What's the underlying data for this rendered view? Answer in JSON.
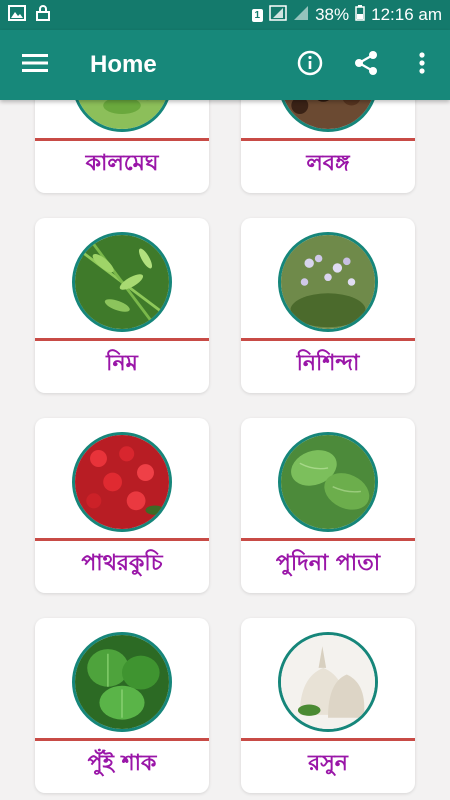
{
  "status_bar": {
    "battery": "38%",
    "time": "12:16 am",
    "sim_label": "1"
  },
  "app_bar": {
    "title": "Home",
    "menu_icon": "hamburger-menu-icon",
    "info_icon": "info-icon",
    "share_icon": "share-icon",
    "more_icon": "more-vert-icon"
  },
  "colors": {
    "app_bar": "#17887a",
    "status_bar": "#147a6c",
    "label": "#9a16a8",
    "divider": "#c84b46",
    "thumb_border": "#16867a"
  },
  "items": [
    {
      "label": "কালমেঘ",
      "image": "kalmegh-leaves"
    },
    {
      "label": "লবঙ্গ",
      "image": "clove-buds"
    },
    {
      "label": "নিম",
      "image": "neem-leaves"
    },
    {
      "label": "নিশিন্দা",
      "image": "nishinda-flowers"
    },
    {
      "label": "পাথরকুচি",
      "image": "patharkuchi-red-flowers"
    },
    {
      "label": "পুদিনা পাতা",
      "image": "mint-leaves"
    },
    {
      "label": "পুঁই শাক",
      "image": "malabar-spinach"
    },
    {
      "label": "রসুন",
      "image": "garlic"
    }
  ]
}
